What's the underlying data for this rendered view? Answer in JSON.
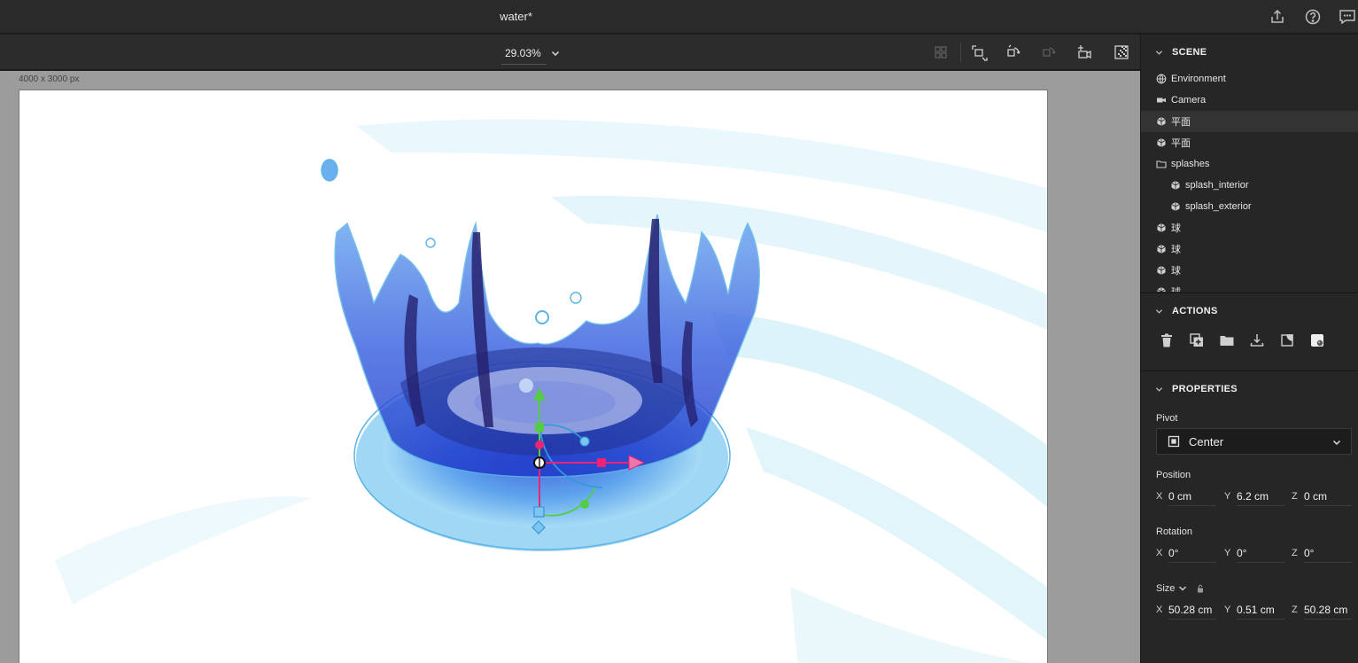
{
  "window": {
    "title": "water*"
  },
  "titlebar_icons": [
    "share-icon",
    "help-icon",
    "comments-icon"
  ],
  "viewport_toolbar": {
    "zoom": "29.03%",
    "tools": [
      "frame-icon",
      "fit-selection-icon",
      "orbit-icon",
      "pan-icon",
      "camera-add-icon",
      "render-preview-icon"
    ]
  },
  "canvas": {
    "doc_size": "4000 x 3000 px"
  },
  "scene": {
    "header": "SCENE",
    "items": [
      {
        "label": "Environment",
        "icon": "environment-icon",
        "indent": 0,
        "selected": false
      },
      {
        "label": "Camera",
        "icon": "camera-icon",
        "indent": 0,
        "selected": false
      },
      {
        "label": "平面",
        "icon": "model-icon",
        "indent": 0,
        "selected": true
      },
      {
        "label": "平面",
        "icon": "model-icon",
        "indent": 0,
        "selected": false
      },
      {
        "label": "splashes",
        "icon": "folder-icon",
        "indent": 0,
        "selected": false
      },
      {
        "label": "splash_interior",
        "icon": "model-icon",
        "indent": 1,
        "selected": false
      },
      {
        "label": "splash_exterior",
        "icon": "model-icon",
        "indent": 1,
        "selected": false
      },
      {
        "label": "球",
        "icon": "model-icon",
        "indent": 0,
        "selected": false
      },
      {
        "label": "球",
        "icon": "model-icon",
        "indent": 0,
        "selected": false
      },
      {
        "label": "球",
        "icon": "model-icon",
        "indent": 0,
        "selected": false
      },
      {
        "label": "球",
        "icon": "model-icon",
        "indent": 0,
        "selected": false
      }
    ]
  },
  "actions": {
    "header": "ACTIONS",
    "buttons": [
      "delete-icon",
      "duplicate-icon",
      "group-icon",
      "drop-to-ground-icon",
      "copy-icon",
      "material-icon"
    ]
  },
  "properties": {
    "header": "PROPERTIES",
    "pivot_label": "Pivot",
    "pivot_value": "Center",
    "position_label": "Position",
    "position": {
      "x": "0 cm",
      "y": "6.2 cm",
      "z": "0 cm"
    },
    "rotation_label": "Rotation",
    "rotation": {
      "x": "0°",
      "y": "0°",
      "z": "0°"
    },
    "size_label": "Size",
    "size": {
      "x": "50.28 cm",
      "y": "0.51 cm",
      "z": "50.28 cm"
    }
  },
  "colors": {
    "selection_outline": "#5ab4e6",
    "gizmo_x": "#ee2277",
    "gizmo_y": "#55cc44",
    "gizmo_z": "#3399dd"
  }
}
